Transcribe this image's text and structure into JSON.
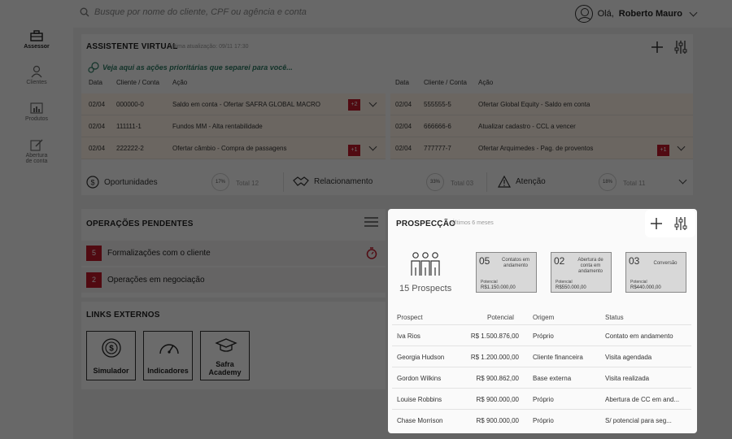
{
  "topbar": {
    "search_placeholder": "Busque por nome do cliente, CPF ou agência e conta",
    "greeting": "Olá,",
    "user_name": "Roberto Mauro"
  },
  "sidebar": {
    "items": [
      {
        "label": "Assessor",
        "icon": "briefcase-icon"
      },
      {
        "label": "Clientes",
        "icon": "person-icon"
      },
      {
        "label": "Produtos",
        "icon": "bar-chart-icon"
      },
      {
        "label": "Abertura de conta",
        "icon": "edit-icon"
      }
    ]
  },
  "assistant": {
    "title": "ASSISTENTE VIRTUAL",
    "updated": "Última atualização: 09/11 17:30",
    "intro": "Veja aqui as ações prioritárias que separei para você...",
    "headers": [
      "Data",
      "Cliente / Conta",
      "Ação"
    ],
    "left_rows": [
      {
        "date": "02/04",
        "account": "000000-0",
        "action": "Saldo em conta - Ofertar SAFRA GLOBAL MACRO",
        "badge": "+2"
      },
      {
        "date": "02/04",
        "account": "111111-1",
        "action": "Fundos MM - Alta rentabilidade",
        "badge": ""
      },
      {
        "date": "02/04",
        "account": "222222-2",
        "action": "Ofertar câmbio - Compra de passagens",
        "badge": "+1"
      }
    ],
    "right_rows": [
      {
        "date": "02/04",
        "account": "555555-5",
        "action": "Ofertar Global Equity - Saldo em conta",
        "badge": ""
      },
      {
        "date": "02/04",
        "account": "666666-6",
        "action": "Atualizar cadastro - CCL a vencer",
        "badge": ""
      },
      {
        "date": "02/04",
        "account": "777777-7",
        "action": "Ofertar Arquimedes - Pag. de proventos",
        "badge": "+1"
      }
    ]
  },
  "summary": {
    "items": [
      {
        "label": "Oportunidades",
        "pct": "17%",
        "total": "Total 12"
      },
      {
        "label": "Relacionamento",
        "pct": "33%",
        "total": "Total 03"
      },
      {
        "label": "Atenção",
        "pct": "18%",
        "total": "Total 11"
      }
    ]
  },
  "pending": {
    "title": "OPERAÇÕES PENDENTES",
    "rows": [
      {
        "count": "5",
        "label": "Formalizações com o cliente"
      },
      {
        "count": "2",
        "label": "Operações em negociação"
      }
    ]
  },
  "links": {
    "title": "LINKS EXTERNOS",
    "items": [
      "Simulador",
      "Indicadores",
      "Safra Academy"
    ]
  },
  "prospection": {
    "title": "PROSPECÇÃO",
    "subtitle": "Últimos 6 meses",
    "prospects_label": "15 Prospects",
    "cards": [
      {
        "num": "05",
        "title": "Contatos em andamento",
        "pot_label": "Potencial",
        "value": "R$1.150.000,00"
      },
      {
        "num": "02",
        "title": "Abertura de conta em andamento",
        "pot_label": "Potencial",
        "value": "R$550.000,00"
      },
      {
        "num": "03",
        "title": "Conversão",
        "pot_label": "Potencial",
        "value": "R$440.000,00"
      }
    ],
    "headers": [
      "Prospect",
      "Potencial",
      "Origem",
      "Status"
    ],
    "rows": [
      {
        "name": "Iva Rios",
        "value": "R$ 1.500.876,00",
        "origin": "Próprio",
        "status": "Contato em andamento"
      },
      {
        "name": "Georgia Hudson",
        "value": "R$ 1.200.000,00",
        "origin": "Cliente financeira",
        "status": "Visita agendada"
      },
      {
        "name": "Gordon Wilkins",
        "value": "R$ 900.862,00",
        "origin": "Base externa",
        "status": "Visita realizada"
      },
      {
        "name": "Louise Robbins",
        "value": "R$ 900.000,00",
        "origin": "Próprio",
        "status": "Abertura de CC em and..."
      },
      {
        "name": "Chase Morrison",
        "value": "R$ 900.000,00",
        "origin": "Próprio",
        "status": "S/ potencial para seg..."
      }
    ]
  }
}
